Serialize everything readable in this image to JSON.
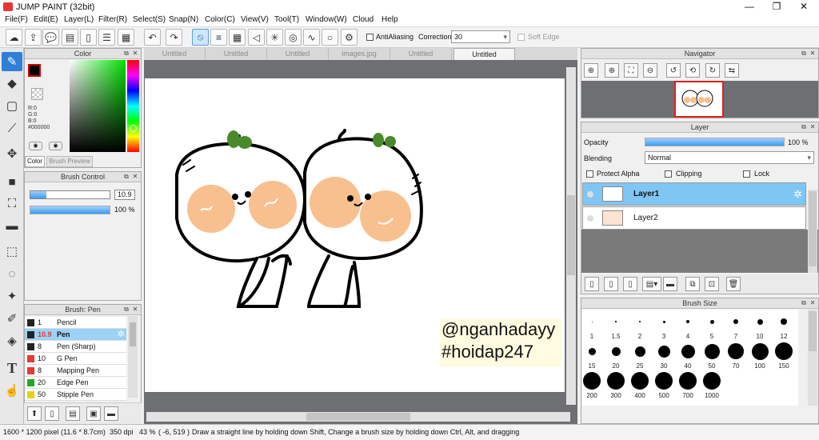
{
  "window": {
    "title": "JUMP PAINT (32bit)",
    "min": "—",
    "max": "❐",
    "close": "✕"
  },
  "menu": [
    "File(F)",
    "Edit(E)",
    "Layer(L)",
    "Filter(R)",
    "Select(S)",
    "Snap(N)",
    "Color(C)",
    "View(V)",
    "Tool(T)",
    "Window(W)",
    "Cloud",
    "Help"
  ],
  "toolbar": {
    "antialias_label": "AntiAliasing",
    "correction_label": "Correction",
    "correction_value": "30",
    "softedge_label": "Soft Edge"
  },
  "color_panel": {
    "title": "Color",
    "r": "R:0",
    "g": "G:0",
    "b": "B:0",
    "hex": "#000000",
    "tab_color": "Color",
    "tab_preview": "Brush Preview"
  },
  "brush_control": {
    "title": "Brush Control",
    "size": "10.9",
    "opacity": "100 %",
    "size_fill": 0.2,
    "opacity_fill": 1.0
  },
  "brush_list": {
    "title": "Brush: Pen",
    "items": [
      {
        "size": "1",
        "name": "Pencil",
        "color": "#222222"
      },
      {
        "size": "10.9",
        "name": "Pen",
        "color": "#222222",
        "selected": true
      },
      {
        "size": "8",
        "name": "Pen (Sharp)",
        "color": "#222222"
      },
      {
        "size": "10",
        "name": "G Pen",
        "color": "#e53935"
      },
      {
        "size": "8",
        "name": "Mapping Pen",
        "color": "#e53935"
      },
      {
        "size": "20",
        "name": "Edge Pen",
        "color": "#22aa22"
      },
      {
        "size": "50",
        "name": "Stipple Pen",
        "color": "#e6d21a"
      }
    ]
  },
  "tabs": [
    "Untitled",
    "Untitled",
    "Untitled",
    "images.jpg",
    "Untitled",
    "Untitled"
  ],
  "active_tab": 5,
  "watermark": {
    "line1": "@nganhadayy",
    "line2": "#hoidap247"
  },
  "navigator": {
    "title": "Navigator"
  },
  "layer_panel": {
    "title": "Layer",
    "opacity_label": "Opacity",
    "opacity_value": "100 %",
    "blending_label": "Blending",
    "blending_value": "Normal",
    "protect_alpha": "Protect Alpha",
    "clipping": "Clipping",
    "lock": "Lock",
    "layers": [
      {
        "name": "Layer1",
        "selected": true
      },
      {
        "name": "Layer2",
        "selected": false
      }
    ]
  },
  "brush_size": {
    "title": "Brush Size",
    "sizes": [
      "1",
      "1.5",
      "2",
      "3",
      "4",
      "5",
      "7",
      "10",
      "12",
      "15",
      "20",
      "25",
      "30",
      "40",
      "50",
      "70",
      "100",
      "150",
      "200",
      "300",
      "400",
      "500",
      "700",
      "1000"
    ]
  },
  "status": {
    "pixels": "1600 * 1200 pixel",
    "cm": "(11.6 * 8.7cm)",
    "dpi": "350 dpi",
    "zoom": "43 %",
    "coords": "( -6, 519 )",
    "hint": "Draw a straight line by holding down Shift, Change a brush size by holding down Ctrl, Alt, and dragging"
  },
  "colors": {
    "accent": "#2f7fd8",
    "selected_row": "#9bd2f5",
    "layer_selected": "#7fc6f4",
    "canvas_bg": "#6d6f73",
    "character_cheek": "#f9c08f",
    "sprout": "#4a8a2a"
  }
}
